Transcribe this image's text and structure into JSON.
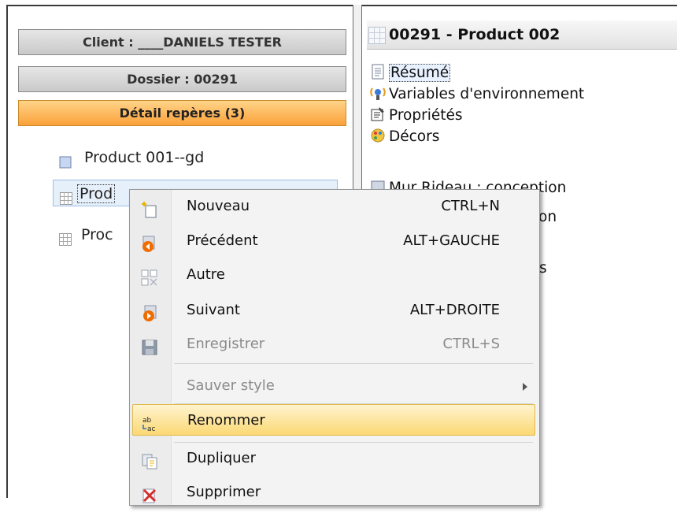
{
  "left_panel": {
    "client_label": "Client : ____DANIELS TESTER",
    "dossier_label": "Dossier : 00291",
    "detail_label": "Détail repères (3)",
    "tree": [
      {
        "label": "Product 001--gd",
        "icon": "square-icon"
      },
      {
        "label": "Prod",
        "icon": "grid-icon"
      },
      {
        "label": "Proc",
        "icon": "grid-icon"
      }
    ]
  },
  "right_panel": {
    "title": "00291 - Product 002",
    "items": [
      {
        "label": "Résumé",
        "icon": "document-icon"
      },
      {
        "label": "Variables d'environnement",
        "icon": "network-icon"
      },
      {
        "label": "Propriétés",
        "icon": "properties-icon"
      },
      {
        "label": "Décors",
        "icon": "palette-icon"
      },
      {
        "label": "Mur Rideau : conception",
        "icon": "wall-icon"
      },
      {
        "label": "on",
        "icon": ""
      },
      {
        "label": "s",
        "icon": ""
      }
    ]
  },
  "context_menu": {
    "items": [
      {
        "label": "Nouveau",
        "shortcut": "CTRL+N",
        "icon": "new-icon",
        "disabled": false
      },
      {
        "label": "Précédent",
        "shortcut": "ALT+GAUCHE",
        "icon": "previous-icon",
        "disabled": false
      },
      {
        "label": "Autre",
        "shortcut": "",
        "icon": "other-icon",
        "disabled": false
      },
      {
        "label": "Suivant",
        "shortcut": "ALT+DROITE",
        "icon": "next-icon",
        "disabled": false
      },
      {
        "label": "Enregistrer",
        "shortcut": "CTRL+S",
        "icon": "save-icon",
        "disabled": true
      },
      {
        "label": "Sauver style",
        "shortcut": "",
        "icon": "",
        "disabled": true,
        "submenu": true
      },
      {
        "label": "Renommer",
        "shortcut": "",
        "icon": "rename-icon",
        "disabled": false,
        "highlighted": true
      },
      {
        "label": "Dupliquer",
        "shortcut": "",
        "icon": "duplicate-icon",
        "disabled": false
      },
      {
        "label": "Supprimer",
        "shortcut": "",
        "icon": "delete-icon",
        "disabled": false
      }
    ]
  },
  "colors": {
    "menu_highlight": "#fbd874",
    "orange_header": "#fba13a",
    "selection": "#e6f0fb"
  }
}
